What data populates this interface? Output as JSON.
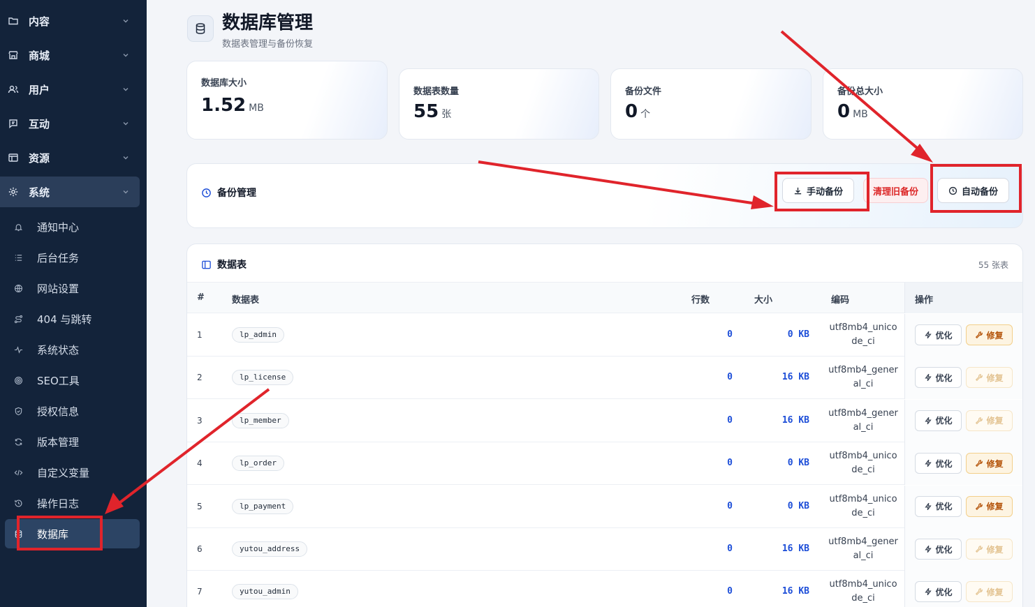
{
  "sidebar": {
    "groups": [
      {
        "label": "内容",
        "icon": "folder-icon"
      },
      {
        "label": "商城",
        "icon": "store-icon"
      },
      {
        "label": "用户",
        "icon": "users-icon"
      },
      {
        "label": "互动",
        "icon": "message-icon"
      },
      {
        "label": "资源",
        "icon": "layout-icon"
      },
      {
        "label": "系统",
        "icon": "settings-icon"
      }
    ],
    "items": [
      {
        "label": "通知中心",
        "icon": "bell-icon"
      },
      {
        "label": "后台任务",
        "icon": "list-icon"
      },
      {
        "label": "网站设置",
        "icon": "globe-icon"
      },
      {
        "label": "404 与跳转",
        "icon": "route-icon"
      },
      {
        "label": "系统状态",
        "icon": "activity-icon"
      },
      {
        "label": "SEO工具",
        "icon": "target-icon"
      },
      {
        "label": "授权信息",
        "icon": "shield-check-icon"
      },
      {
        "label": "版本管理",
        "icon": "refresh-icon"
      },
      {
        "label": "自定义变量",
        "icon": "code-icon"
      },
      {
        "label": "操作日志",
        "icon": "history-icon"
      },
      {
        "label": "数据库",
        "icon": "database-icon"
      }
    ],
    "active_item": "数据库"
  },
  "header": {
    "title": "数据库管理",
    "subtitle": "数据表管理与备份恢复"
  },
  "stats": [
    {
      "label": "数据库大小",
      "value": "1.52",
      "unit": "MB"
    },
    {
      "label": "数据表数量",
      "value": "55",
      "unit": "张"
    },
    {
      "label": "备份文件",
      "value": "0",
      "unit": "个"
    },
    {
      "label": "备份总大小",
      "value": "0",
      "unit": "MB"
    }
  ],
  "backup": {
    "title": "备份管理",
    "manual_label": "手动备份",
    "clean_label": "清理旧备份",
    "auto_label": "自动备份"
  },
  "table_panel": {
    "title": "数据表",
    "count": "55 张表",
    "columns": {
      "num": "#",
      "name": "数据表",
      "rows": "行数",
      "size": "大小",
      "collation": "编码",
      "actions": "操作"
    },
    "optimize_label": "优化",
    "repair_label": "修复",
    "rows": [
      {
        "num": "1",
        "name": "lp_admin",
        "rows": "0",
        "size": "0 KB",
        "collation": "utf8mb4_unicode_ci",
        "repair_enabled": true
      },
      {
        "num": "2",
        "name": "lp_license",
        "rows": "0",
        "size": "16 KB",
        "collation": "utf8mb4_general_ci",
        "repair_enabled": false
      },
      {
        "num": "3",
        "name": "lp_member",
        "rows": "0",
        "size": "16 KB",
        "collation": "utf8mb4_general_ci",
        "repair_enabled": false
      },
      {
        "num": "4",
        "name": "lp_order",
        "rows": "0",
        "size": "0 KB",
        "collation": "utf8mb4_unicode_ci",
        "repair_enabled": true
      },
      {
        "num": "5",
        "name": "lp_payment",
        "rows": "0",
        "size": "0 KB",
        "collation": "utf8mb4_unicode_ci",
        "repair_enabled": true
      },
      {
        "num": "6",
        "name": "yutou_address",
        "rows": "0",
        "size": "16 KB",
        "collation": "utf8mb4_general_ci",
        "repair_enabled": false
      },
      {
        "num": "7",
        "name": "yutou_admin",
        "rows": "0",
        "size": "16 KB",
        "collation": "utf8mb4_unicode_ci",
        "repair_enabled": false
      }
    ]
  },
  "annotation_color": "#e0242b"
}
